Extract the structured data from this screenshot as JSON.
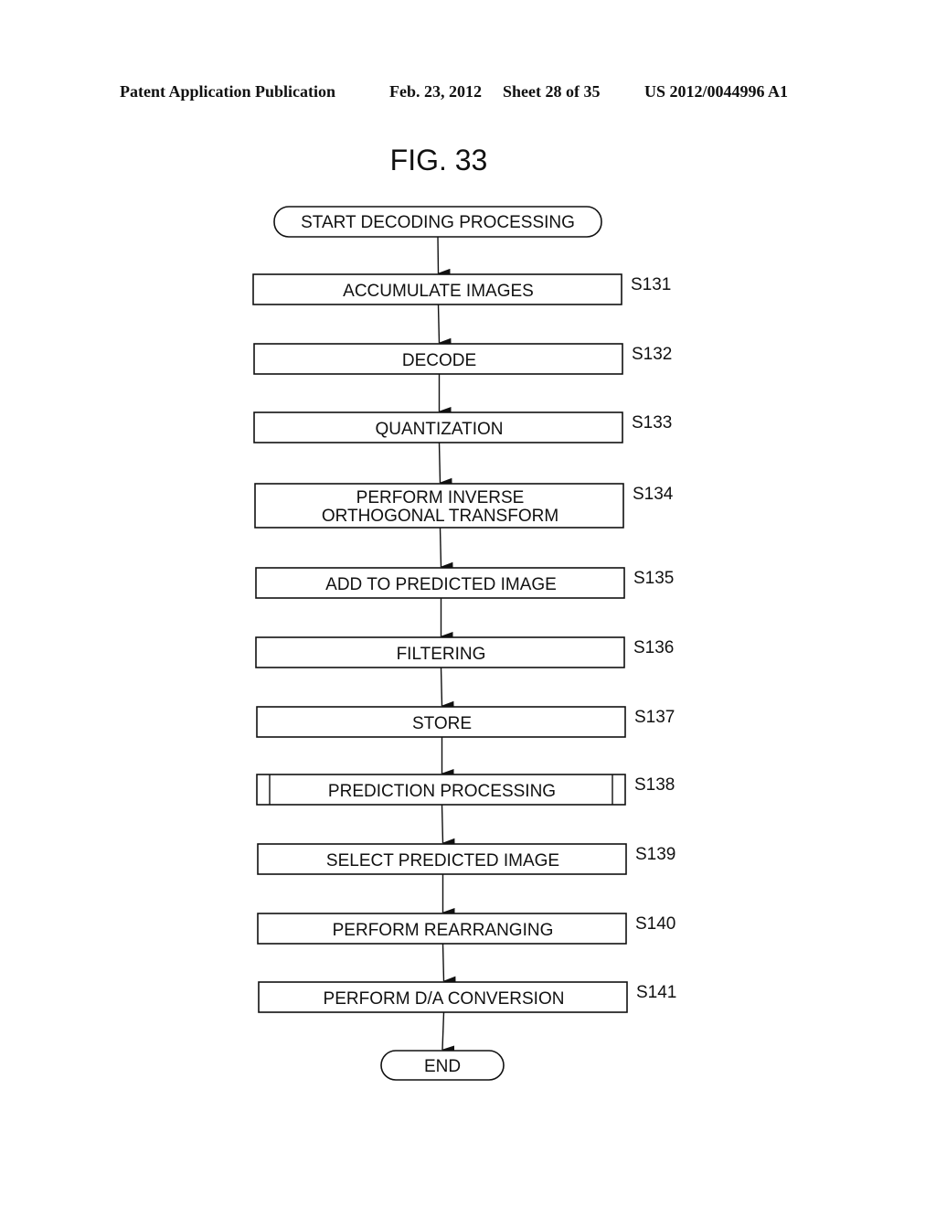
{
  "header": {
    "publication": "Patent Application Publication",
    "date": "Feb. 23, 2012",
    "sheet": "Sheet 28 of 35",
    "number": "US 2012/0044996 A1"
  },
  "figure": {
    "title": "FIG. 33",
    "start": "START DECODING PROCESSING",
    "end": "END",
    "steps": [
      {
        "id": "S131",
        "lines": [
          "ACCUMULATE IMAGES"
        ],
        "subprocess": false
      },
      {
        "id": "S132",
        "lines": [
          "DECODE"
        ],
        "subprocess": false
      },
      {
        "id": "S133",
        "lines": [
          "QUANTIZATION"
        ],
        "subprocess": false
      },
      {
        "id": "S134",
        "lines": [
          "PERFORM INVERSE",
          "ORTHOGONAL TRANSFORM"
        ],
        "subprocess": false
      },
      {
        "id": "S135",
        "lines": [
          "ADD TO PREDICTED IMAGE"
        ],
        "subprocess": false
      },
      {
        "id": "S136",
        "lines": [
          "FILTERING"
        ],
        "subprocess": false
      },
      {
        "id": "S137",
        "lines": [
          "STORE"
        ],
        "subprocess": false
      },
      {
        "id": "S138",
        "lines": [
          "PREDICTION PROCESSING"
        ],
        "subprocess": true
      },
      {
        "id": "S139",
        "lines": [
          "SELECT PREDICTED IMAGE"
        ],
        "subprocess": false
      },
      {
        "id": "S140",
        "lines": [
          "PERFORM REARRANGING"
        ],
        "subprocess": false
      },
      {
        "id": "S141",
        "lines": [
          "PERFORM D/A CONVERSION"
        ],
        "subprocess": false
      }
    ]
  }
}
